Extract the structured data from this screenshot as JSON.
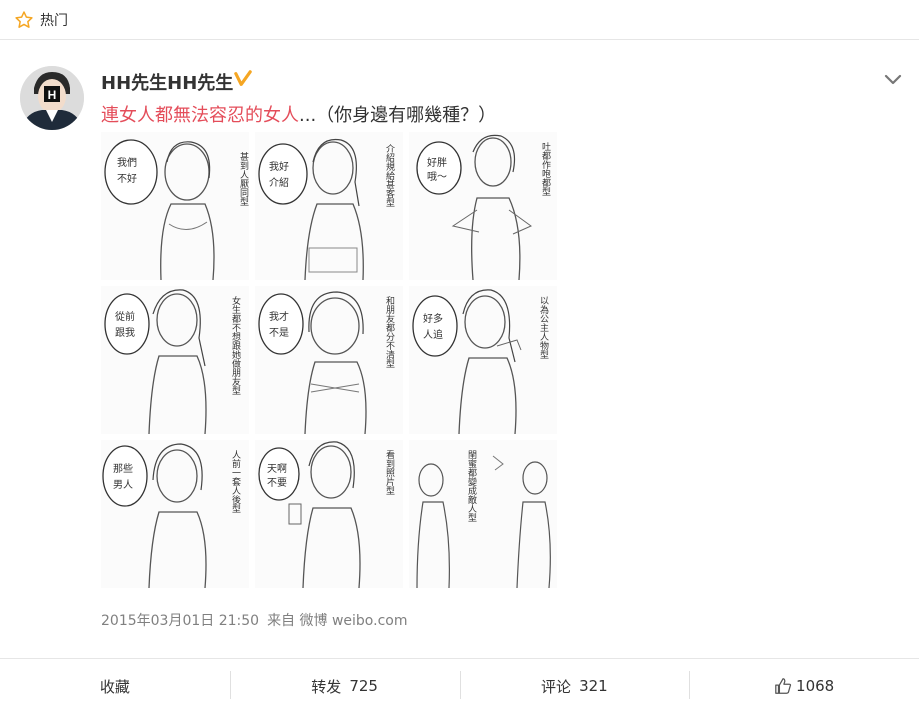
{
  "header": {
    "star_icon": "star-icon",
    "label": "热门"
  },
  "post": {
    "username": "HH先生HH先生",
    "verified_icon": "verified-icon",
    "text_highlight": "連女人都無法容忍的女人",
    "text_rest": "...（你身邊有哪幾種？）",
    "images": [
      {
        "caption": "甚到人厭同型"
      },
      {
        "caption": "介紹規給甚客型"
      },
      {
        "caption": "吐都作咆都型"
      },
      {
        "caption": "女生都不想跟她做朋友型"
      },
      {
        "caption": "和朋友都分不清型"
      },
      {
        "caption": "以為公主人物型"
      },
      {
        "caption": "人前一套人後型"
      },
      {
        "caption": "看到照片型"
      },
      {
        "caption": "閨蜜都變成敵人型"
      }
    ],
    "timestamp": "2015年03月01日 21:50",
    "source": "来自 微博 weibo.com"
  },
  "actions": {
    "favorite": "收藏",
    "repost_label": "转发",
    "repost_count": "725",
    "comment_label": "评论",
    "comment_count": "321",
    "like_count": "1068"
  },
  "colors": {
    "highlight": "#e44d5a",
    "verified": "#f5a623",
    "meta": "#808080"
  }
}
